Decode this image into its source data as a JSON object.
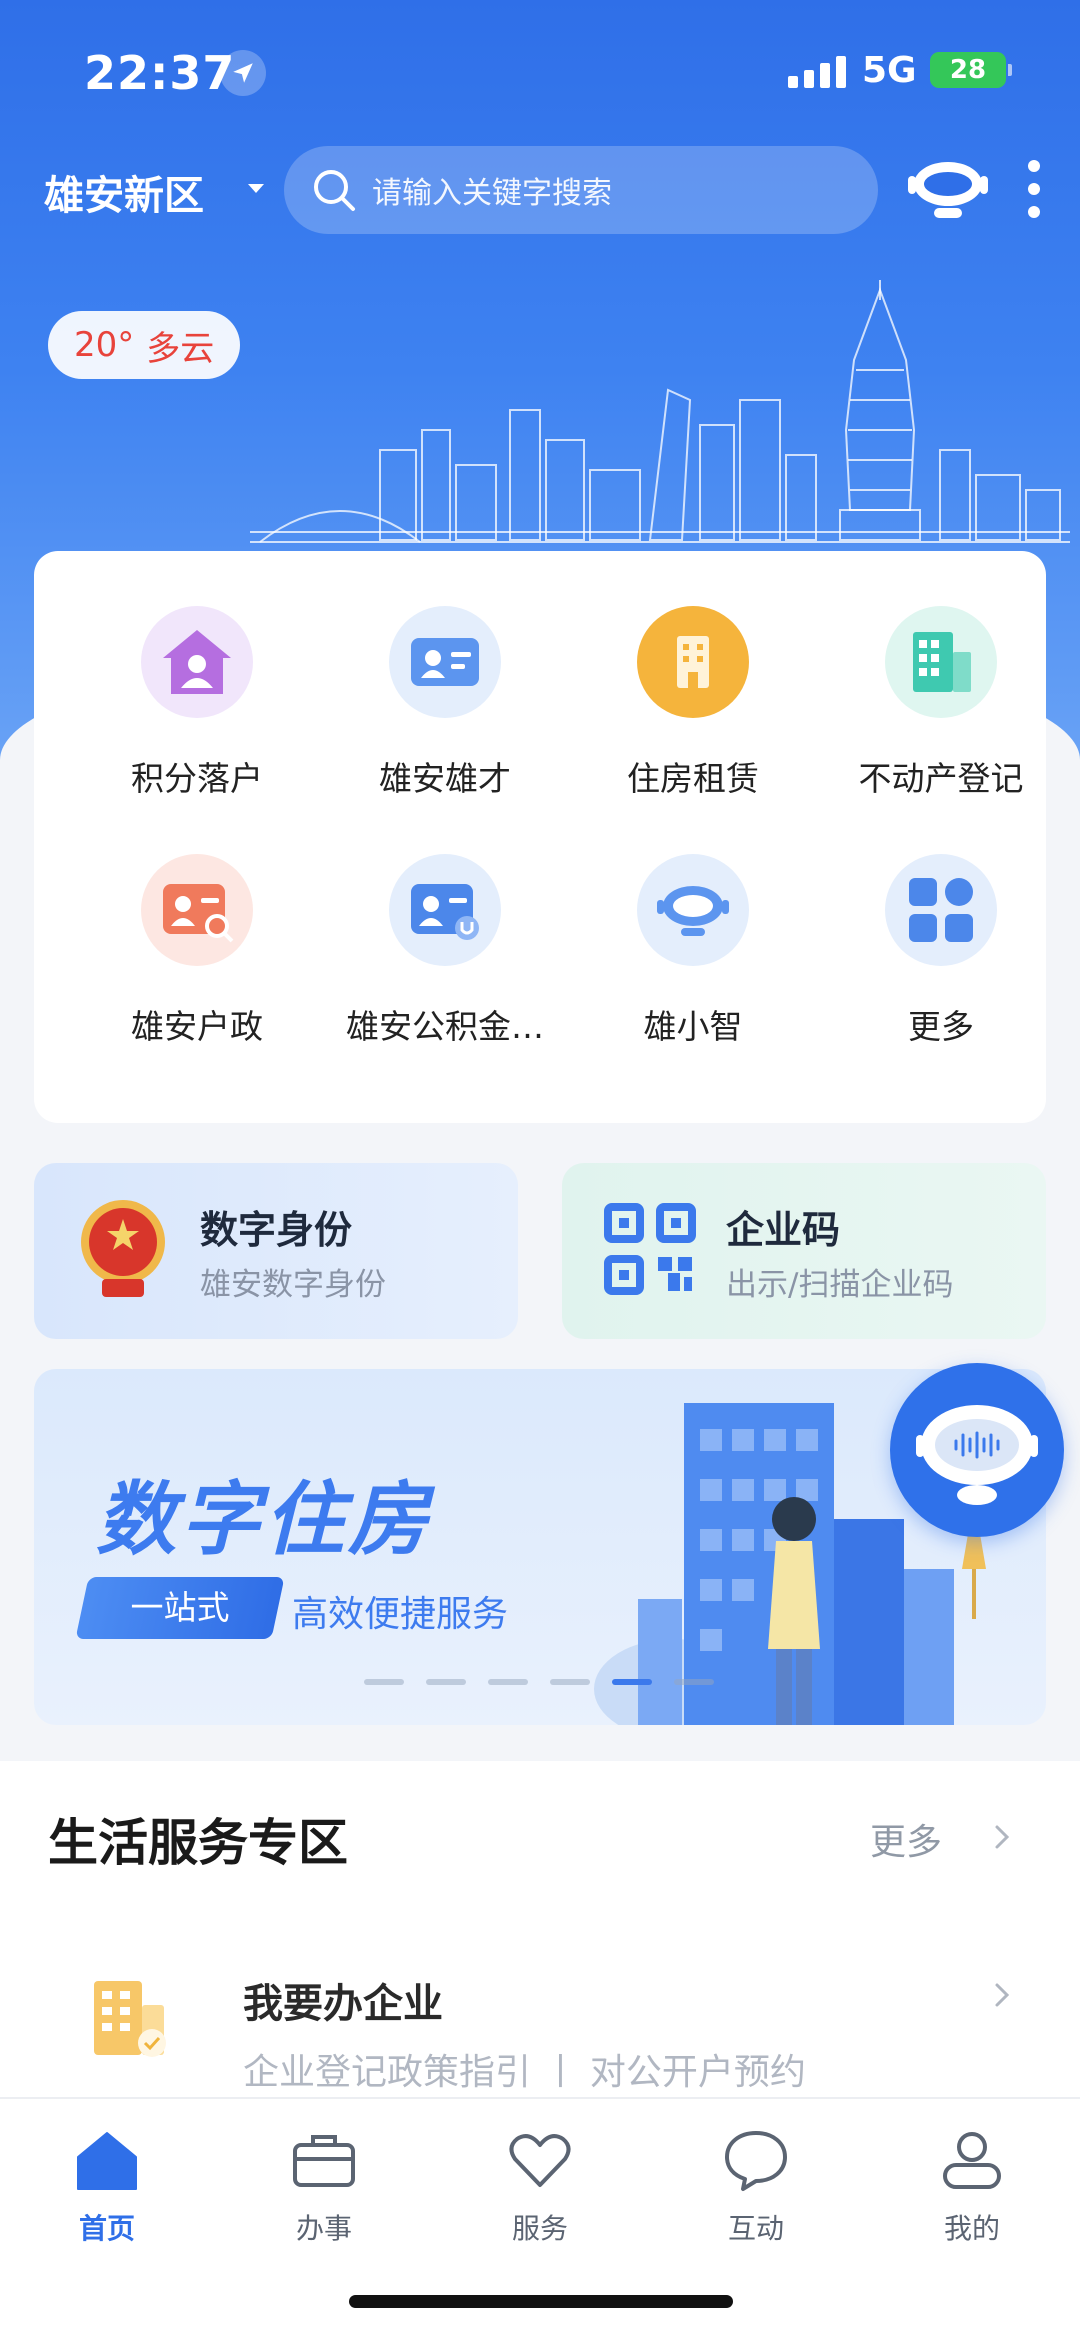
{
  "status_bar": {
    "time": "22:37",
    "network": "5G",
    "battery": "28"
  },
  "top_bar": {
    "region": "雄安新区",
    "search_placeholder": "请输入关键字搜索"
  },
  "weather": {
    "temperature": "20°",
    "condition": "多云"
  },
  "services": [
    {
      "label": "积分落户",
      "icon": "house-person-icon"
    },
    {
      "label": "雄安雄才",
      "icon": "id-card-icon"
    },
    {
      "label": "住房租赁",
      "icon": "building-icon"
    },
    {
      "label": "不动产登记",
      "icon": "office-building-icon"
    },
    {
      "label": "雄安户政",
      "icon": "id-search-icon"
    },
    {
      "label": "雄安公积金…",
      "icon": "id-fund-icon"
    },
    {
      "label": "雄小智",
      "icon": "robot-icon"
    },
    {
      "label": "更多",
      "icon": "grid-more-icon"
    }
  ],
  "quick_cards": {
    "digital_id": {
      "title": "数字身份",
      "subtitle": "雄安数字身份"
    },
    "enterprise_code": {
      "title": "企业码",
      "subtitle": "出示/扫描企业码"
    }
  },
  "banner": {
    "title": "数字住房",
    "tag": "一站式",
    "subtitle": "高效便捷服务",
    "slides": 6,
    "active_slide": 5
  },
  "life_services": {
    "title": "生活服务专区",
    "more": "更多",
    "item": {
      "title": "我要办企业",
      "subtitle": "企业登记政策指引 丨 对公开户预约"
    }
  },
  "tabs": [
    {
      "label": "首页",
      "icon": "home-icon",
      "active": true
    },
    {
      "label": "办事",
      "icon": "briefcase-icon",
      "active": false
    },
    {
      "label": "服务",
      "icon": "heart-icon",
      "active": false
    },
    {
      "label": "互动",
      "icon": "chat-bubble-icon",
      "active": false
    },
    {
      "label": "我的",
      "icon": "user-icon",
      "active": false
    }
  ],
  "colors": {
    "primary": "#2f6fe8",
    "weather_text": "#e8433b",
    "battery": "#34c759"
  }
}
